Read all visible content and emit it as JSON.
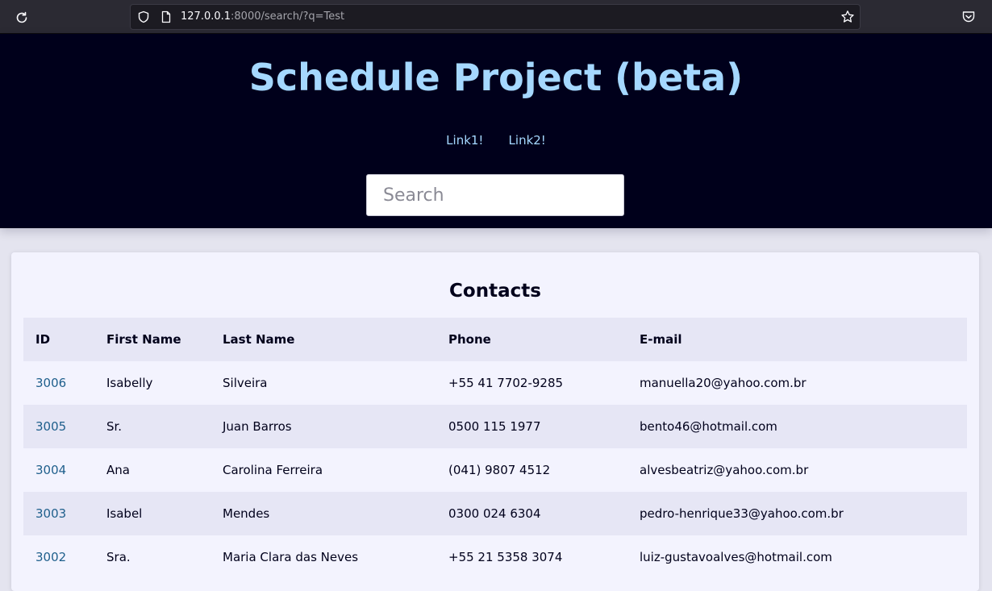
{
  "browser": {
    "url_host": "127.0.0.1",
    "url_rest": ":8000/search/?q=Test"
  },
  "header": {
    "title": "Schedule Project (beta)",
    "nav_links": [
      "Link1!",
      "Link2!"
    ],
    "search_placeholder": "Search"
  },
  "main": {
    "title": "Contacts",
    "columns": [
      "ID",
      "First Name",
      "Last Name",
      "Phone",
      "E-mail"
    ],
    "rows": [
      {
        "id": "3006",
        "first_name": "Isabelly",
        "last_name": "Silveira",
        "phone": "+55 41 7702-9285",
        "email": "manuella20@yahoo.com.br"
      },
      {
        "id": "3005",
        "first_name": "Sr.",
        "last_name": "Juan Barros",
        "phone": "0500 115 1977",
        "email": "bento46@hotmail.com"
      },
      {
        "id": "3004",
        "first_name": "Ana",
        "last_name": "Carolina Ferreira",
        "phone": "(041) 9807 4512",
        "email": "alvesbeatriz@yahoo.com.br"
      },
      {
        "id": "3003",
        "first_name": "Isabel",
        "last_name": "Mendes",
        "phone": "0300 024 6304",
        "email": "pedro-henrique33@yahoo.com.br"
      },
      {
        "id": "3002",
        "first_name": "Sra.",
        "last_name": "Maria Clara das Neves",
        "phone": "+55 21 5358 3074",
        "email": "luiz-gustavoalves@hotmail.com"
      }
    ]
  },
  "colors": {
    "header_bg": "#00001b",
    "title_accent": "#a5d8ff",
    "link": "#1f5f8c",
    "row_alt": "#e6e6f5"
  }
}
